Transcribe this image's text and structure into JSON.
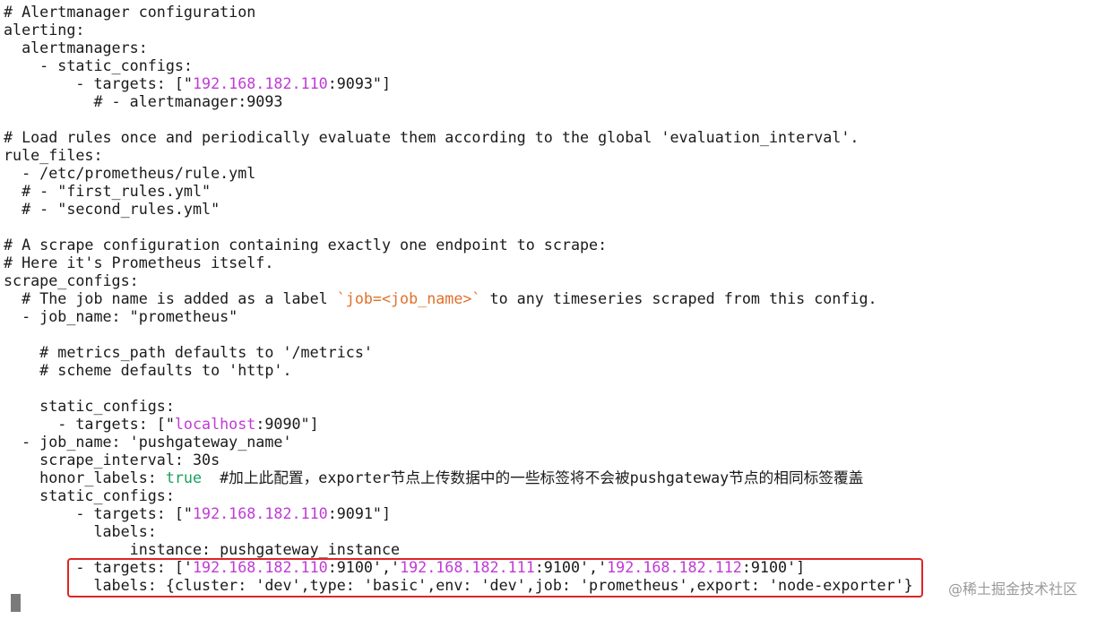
{
  "terminal": {
    "lines": [
      [
        "# Alertmanager configuration"
      ],
      [
        "alerting:"
      ],
      [
        "  alertmanagers:"
      ],
      [
        "    - static_configs:"
      ],
      [
        "        - targets: [\"",
        "192.168.182.110",
        ":9093\"]"
      ],
      [
        "          # - alertmanager:9093"
      ],
      [
        ""
      ],
      [
        "# Load rules once and periodically evaluate them according to the global 'evaluation_interval'."
      ],
      [
        "rule_files:"
      ],
      [
        "  - /etc/prometheus/rule.yml"
      ],
      [
        "  # - \"first_rules.yml\""
      ],
      [
        "  # - \"second_rules.yml\""
      ],
      [
        ""
      ],
      [
        "# A scrape configuration containing exactly one endpoint to scrape:"
      ],
      [
        "# Here it's Prometheus itself."
      ],
      [
        "scrape_configs:"
      ],
      [
        "  # The job name is added as a label ",
        "`job=<job_name>`",
        " to any timeseries scraped from this config."
      ],
      [
        "  - job_name: \"prometheus\""
      ],
      [
        ""
      ],
      [
        "    # metrics_path defaults to '/metrics'"
      ],
      [
        "    # scheme defaults to 'http'."
      ],
      [
        ""
      ],
      [
        "    static_configs:"
      ],
      [
        "      - targets: [\"",
        "localhost",
        ":9090\"]"
      ],
      [
        "  - job_name: 'pushgateway_name'"
      ],
      [
        "    scrape_interval: 30s"
      ],
      [
        "    honor_labels: ",
        "true",
        "  #加上此配置，exporter节点上传数据中的一些标签将不会被pushgateway节点的相同标签覆盖"
      ],
      [
        "    static_configs:"
      ],
      [
        "        - targets: [\"",
        "192.168.182.110",
        ":9091\"]"
      ],
      [
        "          labels:"
      ],
      [
        "              instance: pushgateway_instance"
      ],
      [
        "        - targets: ['",
        "192.168.182.110",
        ":9100','",
        "192.168.182.111",
        ":9100','",
        "192.168.182.112",
        ":9100']"
      ],
      [
        "          labels: {cluster: 'dev',type: 'basic',env: 'dev',job: 'prometheus',export: 'node-exporter'}"
      ]
    ],
    "line_colors": [
      [
        "#1a1a1a"
      ],
      [
        "#1a1a1a"
      ],
      [
        "#1a1a1a"
      ],
      [
        "#1a1a1a"
      ],
      [
        "#1a1a1a",
        "#c03ad6",
        "#1a1a1a"
      ],
      [
        "#1a1a1a"
      ],
      [
        "#1a1a1a"
      ],
      [
        "#1a1a1a"
      ],
      [
        "#1a1a1a"
      ],
      [
        "#1a1a1a"
      ],
      [
        "#1a1a1a"
      ],
      [
        "#1a1a1a"
      ],
      [
        "#1a1a1a"
      ],
      [
        "#1a1a1a"
      ],
      [
        "#1a1a1a"
      ],
      [
        "#1a1a1a"
      ],
      [
        "#1a1a1a",
        "#e0702a",
        "#1a1a1a"
      ],
      [
        "#1a1a1a"
      ],
      [
        "#1a1a1a"
      ],
      [
        "#1a1a1a"
      ],
      [
        "#1a1a1a"
      ],
      [
        "#1a1a1a"
      ],
      [
        "#1a1a1a"
      ],
      [
        "#1a1a1a",
        "#c03ad6",
        "#1a1a1a"
      ],
      [
        "#1a1a1a"
      ],
      [
        "#1a1a1a"
      ],
      [
        "#1a1a1a",
        "#1aa05a",
        "#1a1a1a"
      ],
      [
        "#1a1a1a"
      ],
      [
        "#1a1a1a",
        "#c03ad6",
        "#1a1a1a"
      ],
      [
        "#1a1a1a"
      ],
      [
        "#1a1a1a"
      ],
      [
        "#1a1a1a",
        "#c03ad6",
        "#1a1a1a",
        "#c03ad6",
        "#1a1a1a",
        "#c03ad6",
        "#1a1a1a"
      ],
      [
        "#1a1a1a"
      ]
    ]
  },
  "highlight": {
    "color": "#e02424"
  },
  "cursor": {
    "color": "#7a7a7a"
  },
  "watermark": {
    "text": "@稀土掘金技术社区"
  }
}
